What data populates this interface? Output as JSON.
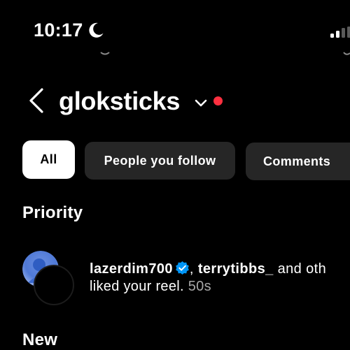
{
  "status_bar": {
    "time": "10:17",
    "moon_icon": "moon-icon",
    "signal_icon": "cellular-signal-icon"
  },
  "header": {
    "back_icon": "chevron-left-icon",
    "username": "gloksticks",
    "dropdown_icon": "chevron-down-icon",
    "notification_dot_color": "#ff3040"
  },
  "filters": [
    {
      "label": "All",
      "active": true
    },
    {
      "label": "People you follow",
      "active": false
    },
    {
      "label": "Comments",
      "active": false
    }
  ],
  "sections": {
    "priority": "Priority",
    "new": "New"
  },
  "notification": {
    "user1": "lazerdim700",
    "verified_icon": "verified-badge-icon",
    "verified_color": "#0095f6",
    "separator": ", ",
    "user2": "terrytibbs_",
    "others_text": " and oth",
    "action": "liked your reel. ",
    "time": "50s"
  }
}
